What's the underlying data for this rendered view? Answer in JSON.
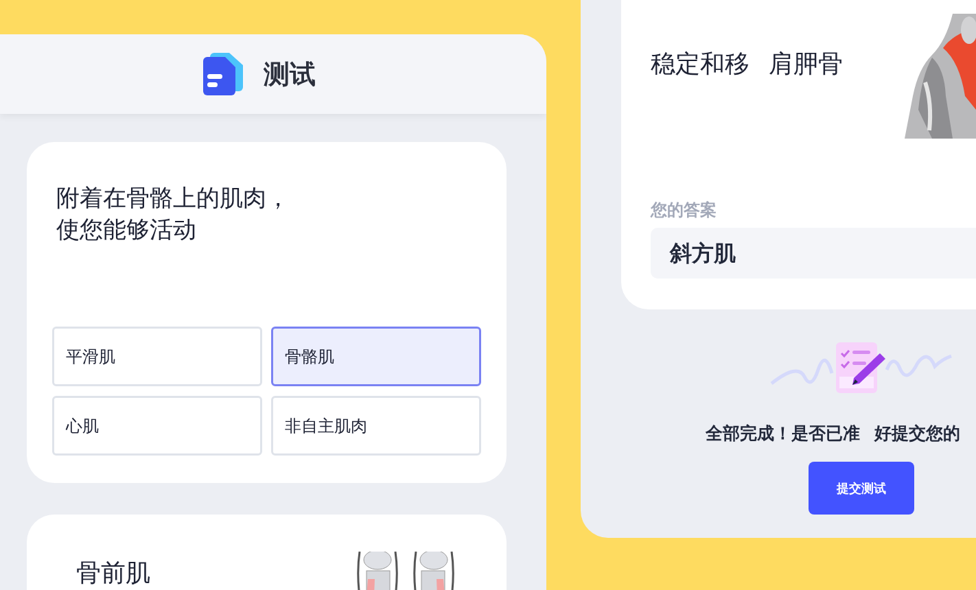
{
  "quiz_window": {
    "title": "测试",
    "question_card": {
      "question": "附着在骨骼上的肌肉，使您能够活动",
      "options": [
        {
          "label": "平滑肌",
          "selected": false
        },
        {
          "label": "骨骼肌",
          "selected": true
        },
        {
          "label": "心肌",
          "selected": false
        },
        {
          "label": "非自主肌肉",
          "selected": false
        }
      ]
    },
    "next_card": {
      "title": "骨前肌",
      "kind": "picture"
    }
  },
  "review_window": {
    "question_card": {
      "title_parts": [
        "稳定和移",
        "肩胛骨"
      ],
      "kind": "picture",
      "answer_label": "您的答案",
      "answer": "斜方肌"
    },
    "completion": {
      "message": "全部完成！是否已准 好提交您的",
      "button": "提交测试"
    }
  }
}
